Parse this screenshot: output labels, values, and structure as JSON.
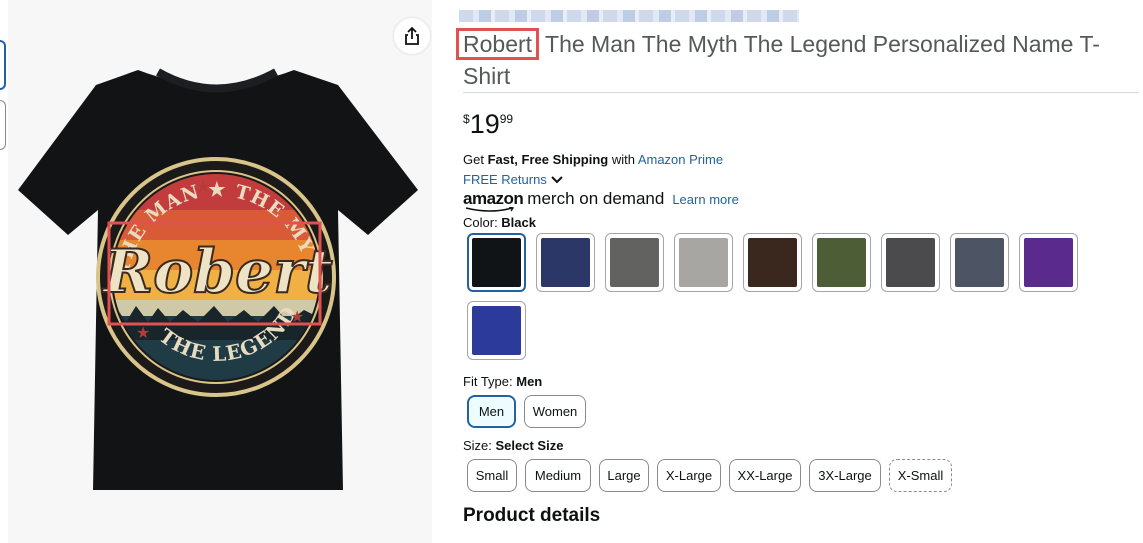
{
  "product": {
    "title_name": "Robert",
    "title_rest": " The Man The Myth The Legend Personalized Name T-Shirt",
    "price_currency": "$",
    "price_whole": "19",
    "price_fraction": "99"
  },
  "shipping": {
    "get_prefix": "Get ",
    "fast_free": "Fast, Free Shipping",
    "with": " with ",
    "prime_link": "Amazon Prime",
    "returns_link": "FREE Returns"
  },
  "merch": {
    "logo_text": "amazon",
    "logo_rest": "merch on demand",
    "learn_more": "Learn more"
  },
  "color": {
    "label": "Color: ",
    "value": "Black",
    "swatches": [
      {
        "name": "Black",
        "hex": "#111417"
      },
      {
        "name": "Navy",
        "hex": "#2b3766"
      },
      {
        "name": "Asphalt",
        "hex": "#626260"
      },
      {
        "name": "Heather Grey",
        "hex": "#a7a6a2"
      },
      {
        "name": "Brown",
        "hex": "#3a271d"
      },
      {
        "name": "Olive",
        "hex": "#4d5d35"
      },
      {
        "name": "Dark Heather",
        "hex": "#4b4b4d"
      },
      {
        "name": "Heather Blue",
        "hex": "#4d5565"
      },
      {
        "name": "Purple",
        "hex": "#5a2a8c"
      },
      {
        "name": "Royal Blue",
        "hex": "#2b3a9b"
      }
    ]
  },
  "fit": {
    "label": "Fit Type: ",
    "value": "Men",
    "options": [
      "Men",
      "Women"
    ]
  },
  "size": {
    "label": "Size: ",
    "value": "Select Size",
    "options": [
      "Small",
      "Medium",
      "Large",
      "X-Large",
      "XX-Large",
      "3X-Large",
      "X-Small"
    ]
  },
  "section": {
    "product_details": "Product details"
  },
  "image": {
    "shirt_print_name": "Robert",
    "shirt_top_text": "THE MAN ★ THE MYTH",
    "shirt_bottom_text": "THE LEGEND"
  },
  "colors": {
    "accent": "#2162a1",
    "highlight": "#e05252"
  }
}
